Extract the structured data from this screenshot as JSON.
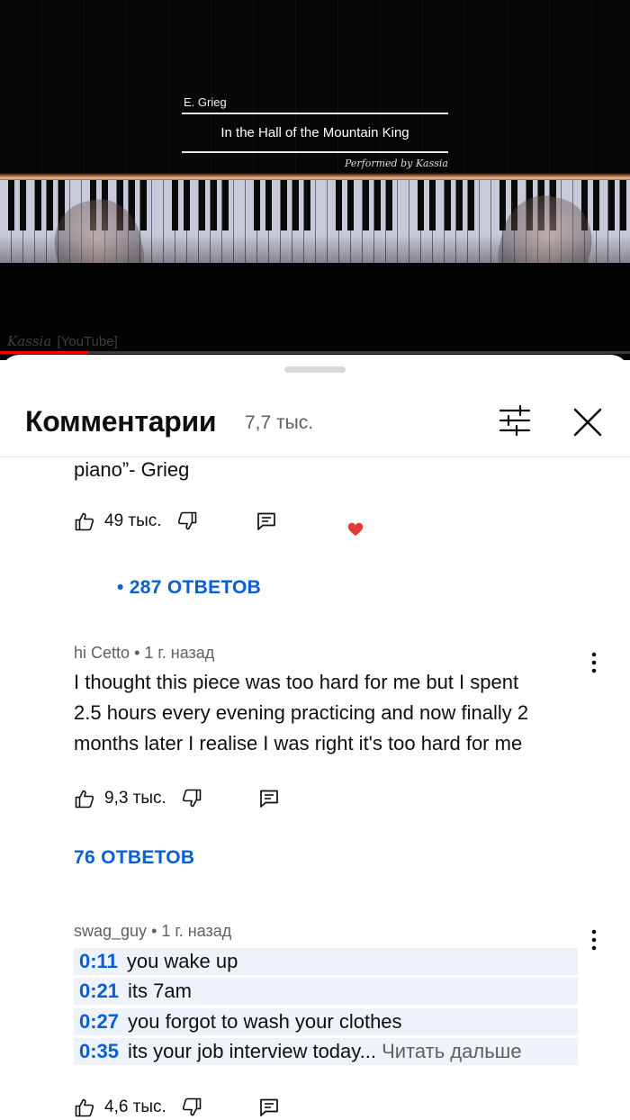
{
  "video": {
    "composer": "E. Grieg",
    "piece_title": "In the Hall of the Mountain King",
    "performer": "Performed by Kassia",
    "watermark_signature": "Kassia",
    "watermark_source": "[YouTube]",
    "progress_fraction": 0.14
  },
  "comments_panel": {
    "title": "Комментарии",
    "count": "7,7 тыс.",
    "filter_icon": "sliders-icon",
    "close_icon": "close-icon"
  },
  "comments": [
    {
      "text_tail": "piano”- Grieg",
      "likes": "49 тыс.",
      "creator_heart": true,
      "replies_label": "• 287 ОТВЕТОВ"
    },
    {
      "author": "hi Cetto",
      "age": "• 1 г. назад",
      "text_lines": [
        "I thought this piece was too hard for me but I spent",
        "2.5 hours every evening practicing and now finally 2",
        "months later I realise I was right it's too hard for me"
      ],
      "likes": "9,3 тыс.",
      "replies_label": "76 ОТВЕТОВ"
    },
    {
      "author": "swag_guy",
      "age": "• 1 г. назад",
      "timestamps": [
        {
          "time": "0:11",
          "text": "you wake up"
        },
        {
          "time": "0:21",
          "text": "its 7am"
        },
        {
          "time": "0:27",
          "text": "you forgot to wash your clothes"
        },
        {
          "time": "0:35",
          "text": "its your job interview today..."
        }
      ],
      "read_more": "Читать дальше",
      "likes": "4,6 тыс."
    }
  ],
  "colors": {
    "link_blue": "#065fd4",
    "heart_red": "#e53935",
    "progress_red": "#ff0000",
    "meta_grey": "#606060"
  }
}
